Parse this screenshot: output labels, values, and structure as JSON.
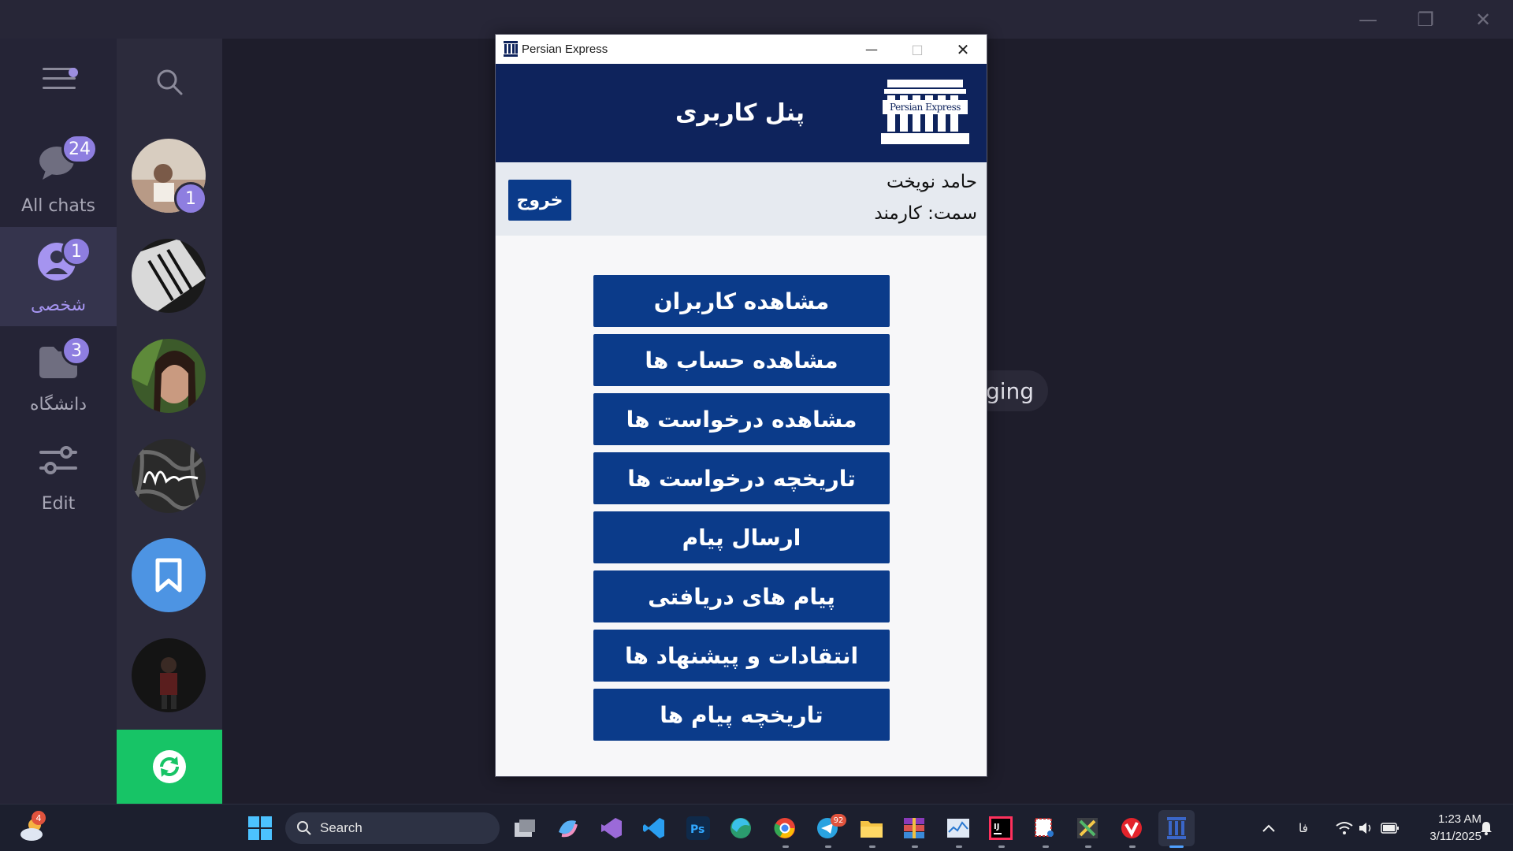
{
  "telegram": {
    "folders": [
      {
        "label": "All chats",
        "badge": "24",
        "icon": "chats-icon"
      },
      {
        "label": "شخصی",
        "badge": "1",
        "icon": "person-icon"
      },
      {
        "label": "دانشگاه",
        "badge": "3",
        "icon": "folder-icon"
      },
      {
        "label": "Edit",
        "badge": "",
        "icon": "sliders-icon"
      }
    ],
    "first_chat_unread": "1",
    "main_pill_text": "ging"
  },
  "app": {
    "title": "Persian Express",
    "panel_title": "پنل کاربری",
    "logo_text": "Persian Express",
    "user_name": "حامد نویخت",
    "user_role": "سمت:  کارمند",
    "exit_label": "خروج",
    "menu": [
      "مشاهده کاربران",
      "مشاهده حساب ها",
      "مشاهده درخواست ها",
      "تاریخچه درخواست ها",
      "ارسال پیام",
      "پیام های دریافتی",
      "انتقادات و پیشنهاد ها",
      "تاریخچه پیام ها"
    ]
  },
  "taskbar": {
    "search_placeholder": "Search",
    "weather_badge": "4",
    "telegram_badge": "92",
    "language": "فا",
    "time": "1:23 AM",
    "date": "3/11/2025"
  },
  "colors": {
    "header": "#0e235c",
    "button": "#0b3b8a",
    "accent": "#8e7ee0"
  }
}
